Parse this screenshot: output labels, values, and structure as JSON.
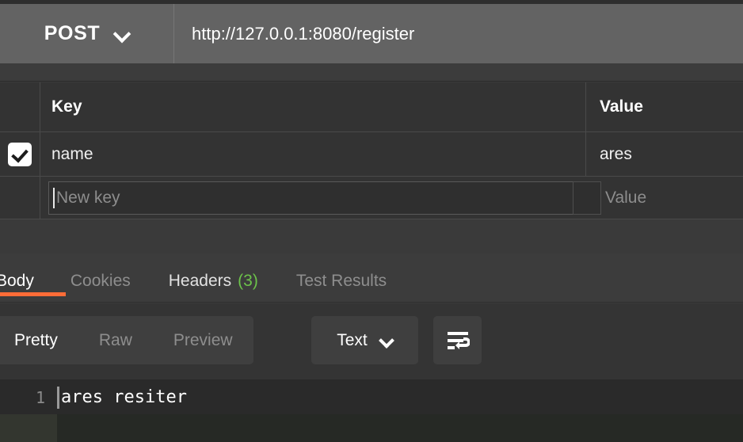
{
  "request": {
    "method": "POST",
    "method_caret_icon": "chevron-down-icon",
    "url": "http://127.0.0.1:8080/register"
  },
  "params_table": {
    "columns": {
      "key": "Key",
      "value": "Value"
    },
    "rows": [
      {
        "enabled": true,
        "key": "name",
        "value": "ares"
      }
    ],
    "new_row": {
      "key_placeholder": "New key",
      "value_placeholder": "Value"
    }
  },
  "response_tabs": {
    "items": [
      {
        "label": "Body",
        "active": true,
        "count": ""
      },
      {
        "label": "Cookies",
        "active": false,
        "count": ""
      },
      {
        "label": "Headers",
        "active": false,
        "count": "(3)"
      },
      {
        "label": "Test Results",
        "active": false,
        "count": ""
      }
    ],
    "accent_color": "#ff6c37"
  },
  "response_toolbar": {
    "view_modes": [
      {
        "label": "Pretty",
        "active": true
      },
      {
        "label": "Raw",
        "active": false
      },
      {
        "label": "Preview",
        "active": false
      }
    ],
    "format": {
      "label": "Text",
      "caret_icon": "chevron-down-icon"
    },
    "wrap_icon": "wrap-text-icon"
  },
  "response_body": {
    "lines": [
      {
        "number": "1",
        "text": "ares resiter"
      }
    ]
  }
}
